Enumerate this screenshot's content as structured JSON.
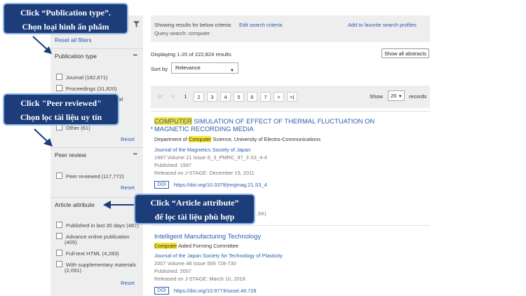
{
  "sidebar": {
    "reset_all": "Reset all filters",
    "sections": [
      {
        "title": "Publication type",
        "toggle": "−",
        "options": [
          "Journal (182,671)",
          "Proceedings (31,820)",
          "…nical",
          "Other (61)"
        ],
        "reset": "Reset"
      },
      {
        "title": "Peer review",
        "toggle": "−",
        "options": [
          "Peer reviewed (117,772)"
        ],
        "reset": "Reset"
      },
      {
        "title": "Article attribute",
        "toggle": "−",
        "options": [
          "Published in last 30 days (487)",
          "Advance online publication",
          "(405)",
          "Full-text HTML (4,283)",
          "With supplementary materials",
          "(2,091)"
        ],
        "reset": "Reset"
      }
    ]
  },
  "criteria": {
    "label": "Showing results for below criteria:",
    "edit": "Edit search criteria",
    "favorite": "Add to favorite search profiles",
    "query_label": "Query search:",
    "query": "computer"
  },
  "results": {
    "displaying": "Displaying 1-20 of 222,824 results",
    "show_abstracts": "Show all abstracts",
    "sort_label": "Sort by",
    "sort_value": "Relevance"
  },
  "pager": {
    "items": [
      "|<",
      "<",
      "1",
      "2",
      "3",
      "4",
      "5",
      "6",
      "7",
      ">",
      ">|"
    ],
    "show_label": "Show",
    "show_value": "20",
    "records_label": "records"
  },
  "articles": [
    {
      "title_hl": "COMPUTER",
      "title_rest": " SIMULATION OF EFFECT OF THERMAL FLUCTUATION ON",
      "title_line2": "MAGNETIC RECORDING MEDIA",
      "author_pre": "Department of ",
      "author_hl": "Computer",
      "author_post": " Science, University of Electro-Communications",
      "journal": "Journal of the Magnetics Society of Japan",
      "volume": "1997 Volume 21 Issue S_3_PMRC_97_3 S3_4-4",
      "published": "Published: 1997",
      "released": "Released on J-STAGE: December 15, 2011",
      "doi_badge": "DOI",
      "doi": "https://doi.org/10.3379/jmsjmag.21.S3_4",
      "extra": "…SK)"
    },
    {
      "title": "Intelligent Manufacturing Technology",
      "author_hl": "Computer",
      "author_post": " Aided Forming Committee",
      "journal": "Journal of the Japan Society for Technology of Plasticity",
      "volume": "2007 Volume 48 Issue 559 728-730",
      "published": "Published: 2007",
      "released": "Released on J-STAGE: March 10, 2018",
      "doi_badge": "DOI",
      "doi": "https://doi.org/10.9773/sosei.48.728"
    }
  ],
  "callouts": {
    "c1_line1": "Click “Publication type”.",
    "c1_line2": "Chọn loại hình ấn phẩm",
    "c2_line1": "Click \"Peer reviewed\"",
    "c2_line2": "Chọn lọc tài liệu uy tín",
    "c3_line1": "Click “Article attribute”",
    "c3_line2": "để lọc tài liệu phù hợp"
  },
  "colors": {
    "link": "#2a5db0",
    "highlight": "#f5e430",
    "callout_bg": "#1c3c7a",
    "panel": "#eeeeee"
  }
}
